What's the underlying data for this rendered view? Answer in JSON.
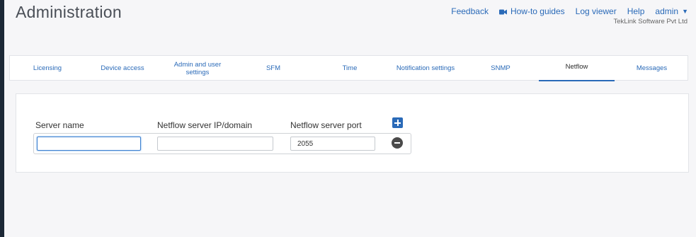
{
  "header": {
    "title": "Administration",
    "nav": {
      "feedback": "Feedback",
      "howto": "How-to guides",
      "logviewer": "Log viewer",
      "help": "Help",
      "user": "admin"
    },
    "company": "TekLink Software Pvt Ltd"
  },
  "tabs": [
    {
      "label": "Licensing"
    },
    {
      "label": "Device access"
    },
    {
      "label": "Admin and user settings"
    },
    {
      "label": "SFM"
    },
    {
      "label": "Time"
    },
    {
      "label": "Notification settings"
    },
    {
      "label": "SNMP"
    },
    {
      "label": "Netflow",
      "active": true
    },
    {
      "label": "Messages"
    }
  ],
  "netflow": {
    "columns": {
      "server_name": "Server name",
      "ip_domain": "Netflow server IP/domain",
      "port": "Netflow server port"
    },
    "row": {
      "server_name": "",
      "ip_domain": "",
      "port": "2055"
    }
  },
  "colors": {
    "accent": "#2a6ab8",
    "sidebar": "#1c2836",
    "background": "#f6f6f8"
  }
}
